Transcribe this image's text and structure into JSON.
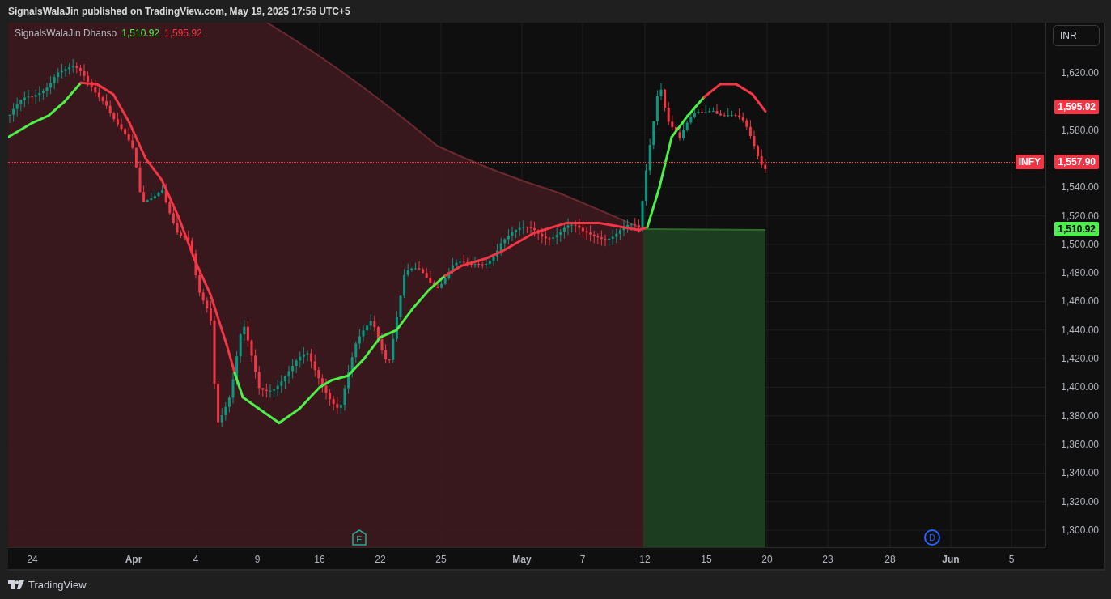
{
  "header": {
    "text": "SignalsWalaJin published on TradingView.com, May 19, 2025 17:56 UTC+5"
  },
  "legend": {
    "name": "SignalsWalaJin Dhanso",
    "values": [
      {
        "text": "1,510.92",
        "color": "#4cf04a"
      },
      {
        "text": "1,595.92",
        "color": "#f23645"
      }
    ]
  },
  "currency": "INR",
  "price_axis": {
    "ticks": [
      "1,620.00",
      "1,580.00",
      "1,540.00",
      "1,520.00",
      "1,500.00",
      "1,480.00",
      "1,460.00",
      "1,440.00",
      "1,420.00",
      "1,400.00",
      "1,380.00",
      "1,360.00",
      "1,340.00",
      "1,320.00",
      "1,300.00"
    ]
  },
  "price_labels": [
    {
      "kind": "value",
      "text": "1,595.92",
      "color": "#f23645"
    },
    {
      "kind": "last",
      "symbol": "INFY",
      "text": "1,557.90",
      "color": "#f23645"
    },
    {
      "kind": "value",
      "text": "1,510.92",
      "color": "#4cf04a"
    }
  ],
  "time_axis": {
    "ticks": [
      {
        "text": "24",
        "bold": false
      },
      {
        "text": "Apr",
        "bold": true
      },
      {
        "text": "4",
        "bold": false
      },
      {
        "text": "9",
        "bold": false
      },
      {
        "text": "16",
        "bold": false
      },
      {
        "text": "22",
        "bold": false
      },
      {
        "text": "25",
        "bold": false
      },
      {
        "text": "May",
        "bold": true
      },
      {
        "text": "7",
        "bold": false
      },
      {
        "text": "12",
        "bold": false
      },
      {
        "text": "15",
        "bold": false
      },
      {
        "text": "20",
        "bold": false
      },
      {
        "text": "23",
        "bold": false
      },
      {
        "text": "28",
        "bold": false
      },
      {
        "text": "Jun",
        "bold": true
      },
      {
        "text": "5",
        "bold": false
      }
    ]
  },
  "markers": [
    {
      "kind": "earnings",
      "text": "E"
    },
    {
      "kind": "dividend",
      "text": "D"
    }
  ],
  "footer": {
    "logo": "TradingView"
  }
}
